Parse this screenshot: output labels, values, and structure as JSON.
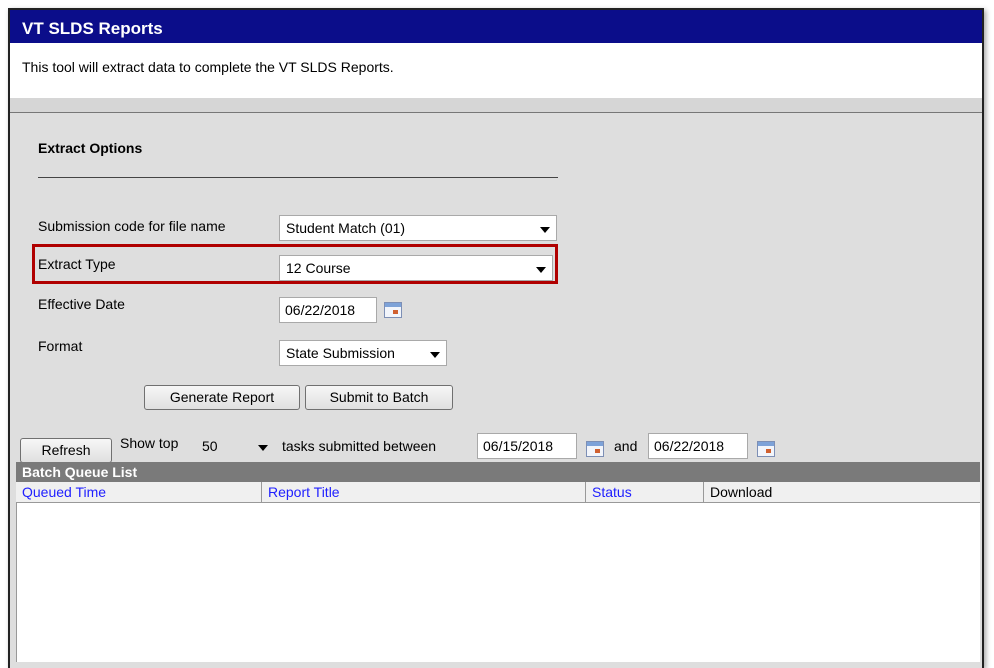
{
  "window": {
    "title": "VT SLDS Reports"
  },
  "description": "This tool will extract data to complete the VT SLDS Reports.",
  "extract_options": {
    "title": "Extract Options",
    "submission_code": {
      "label": "Submission code for file name",
      "value": "Student Match (01)"
    },
    "extract_type": {
      "label": "Extract Type",
      "value": "12 Course"
    },
    "effective_date": {
      "label": "Effective Date",
      "value": "06/22/2018"
    },
    "format": {
      "label": "Format",
      "value": "State Submission"
    }
  },
  "actions": {
    "generate": "Generate Report",
    "submit_batch": "Submit to Batch"
  },
  "batch_filter": {
    "refresh": "Refresh",
    "show_top_label": "Show top",
    "show_top_value": "50",
    "between_label": "tasks submitted between",
    "start_date": "06/15/2018",
    "and_label": "and",
    "end_date": "06/22/2018"
  },
  "batch_queue": {
    "title": "Batch Queue List",
    "columns": [
      "Queued Time",
      "Report Title",
      "Status",
      "Download"
    ],
    "rows": []
  },
  "colors": {
    "title_bar": "#0b0d8a",
    "highlight_box": "#b00000",
    "link": "#2020ff"
  }
}
